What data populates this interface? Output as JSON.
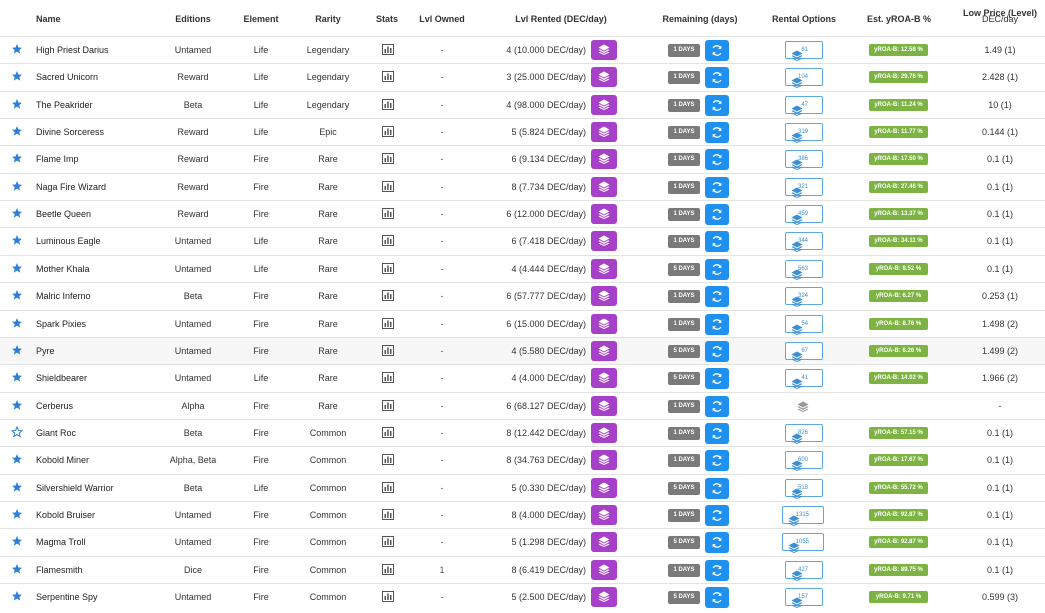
{
  "headers": {
    "name": "Name",
    "editions": "Editions",
    "element": "Element",
    "rarity": "Rarity",
    "stats": "Stats",
    "lvl_owned": "Lvl Owned",
    "lvl_rented": "Lvl Rented",
    "lvl_rented_unit": "(DEC/day)",
    "remaining": "Remaining (days)",
    "rental_options": "Rental Options",
    "est_yroa": "Est. yROA-B %",
    "low_price": "Low Price (Level)",
    "low_price_unit": "DEC/day"
  },
  "colors": {
    "accent_blue": "#1e90f0",
    "purple": "#a640c8",
    "days_badge": "#7a7a7a",
    "yroa_green": "#7cb342"
  },
  "rows": [
    {
      "favorite": true,
      "name": "High Priest Darius",
      "editions": "Untamed",
      "element": "Life",
      "rarity": "Legendary",
      "lvl_owned": "-",
      "lvl": "4",
      "dec": "(10.000 DEC/day)",
      "days": "1 DAYS",
      "rental_count": "81",
      "yroa": "yROA-B: 12.58 %",
      "low_price": "1.49 (1)"
    },
    {
      "favorite": true,
      "name": "Sacred Unicorn",
      "editions": "Reward",
      "element": "Life",
      "rarity": "Legendary",
      "lvl_owned": "-",
      "lvl": "3",
      "dec": "(25.000 DEC/day)",
      "days": "1 DAYS",
      "rental_count": "104",
      "yroa": "yROA-B: 29.76 %",
      "low_price": "2.428 (1)"
    },
    {
      "favorite": true,
      "name": "The Peakrider",
      "editions": "Beta",
      "element": "Life",
      "rarity": "Legendary",
      "lvl_owned": "-",
      "lvl": "4",
      "dec": "(98.000 DEC/day)",
      "days": "1 DAYS",
      "rental_count": "47",
      "yroa": "yROA-B: 11.24 %",
      "low_price": "10 (1)"
    },
    {
      "favorite": true,
      "name": "Divine Sorceress",
      "editions": "Reward",
      "element": "Life",
      "rarity": "Epic",
      "lvl_owned": "-",
      "lvl": "5",
      "dec": "(5.824 DEC/day)",
      "days": "1 DAYS",
      "rental_count": "319",
      "yroa": "yROA-B: 11.77 %",
      "low_price": "0.144 (1)"
    },
    {
      "favorite": true,
      "name": "Flame Imp",
      "editions": "Reward",
      "element": "Fire",
      "rarity": "Rare",
      "lvl_owned": "-",
      "lvl": "6",
      "dec": "(9.134 DEC/day)",
      "days": "1 DAYS",
      "rental_count": "386",
      "yroa": "yROA-B: 17.50 %",
      "low_price": "0.1 (1)"
    },
    {
      "favorite": true,
      "name": "Naga Fire Wizard",
      "editions": "Reward",
      "element": "Fire",
      "rarity": "Rare",
      "lvl_owned": "-",
      "lvl": "8",
      "dec": "(7.734 DEC/day)",
      "days": "1 DAYS",
      "rental_count": "321",
      "yroa": "yROA-B: 27.46 %",
      "low_price": "0.1 (1)"
    },
    {
      "favorite": true,
      "name": "Beetle Queen",
      "editions": "Reward",
      "element": "Fire",
      "rarity": "Rare",
      "lvl_owned": "-",
      "lvl": "6",
      "dec": "(12.000 DEC/day)",
      "days": "1 DAYS",
      "rental_count": "459",
      "yroa": "yROA-B: 13.37 %",
      "low_price": "0.1 (1)"
    },
    {
      "favorite": true,
      "name": "Luminous Eagle",
      "editions": "Untamed",
      "element": "Life",
      "rarity": "Rare",
      "lvl_owned": "-",
      "lvl": "6",
      "dec": "(7.418 DEC/day)",
      "days": "1 DAYS",
      "rental_count": "344",
      "yroa": "yROA-B: 34.11 %",
      "low_price": "0.1 (1)"
    },
    {
      "favorite": true,
      "name": "Mother Khala",
      "editions": "Untamed",
      "element": "Life",
      "rarity": "Rare",
      "lvl_owned": "-",
      "lvl": "4",
      "dec": "(4.444 DEC/day)",
      "days": "5 DAYS",
      "rental_count": "563",
      "yroa": "yROA-B: 8.52 %",
      "low_price": "0.1 (1)"
    },
    {
      "favorite": true,
      "name": "Malric Inferno",
      "editions": "Beta",
      "element": "Fire",
      "rarity": "Rare",
      "lvl_owned": "-",
      "lvl": "6",
      "dec": "(57.777 DEC/day)",
      "days": "1 DAYS",
      "rental_count": "324",
      "yroa": "yROA-B: 6.27 %",
      "low_price": "0.253 (1)"
    },
    {
      "favorite": true,
      "name": "Spark Pixies",
      "editions": "Untamed",
      "element": "Fire",
      "rarity": "Rare",
      "lvl_owned": "-",
      "lvl": "6",
      "dec": "(15.000 DEC/day)",
      "days": "1 DAYS",
      "rental_count": "54",
      "yroa": "yROA-B: 8.76 %",
      "low_price": "1.498 (2)"
    },
    {
      "favorite": true,
      "name": "Pyre",
      "editions": "Untamed",
      "element": "Fire",
      "rarity": "Rare",
      "lvl_owned": "-",
      "lvl": "4",
      "dec": "(5.580 DEC/day)",
      "days": "5 DAYS",
      "rental_count": "67",
      "yroa": "yROA-B: 6.26 %",
      "low_price": "1.499 (2)"
    },
    {
      "favorite": true,
      "name": "Shieldbearer",
      "editions": "Untamed",
      "element": "Life",
      "rarity": "Rare",
      "lvl_owned": "-",
      "lvl": "4",
      "dec": "(4.000 DEC/day)",
      "days": "5 DAYS",
      "rental_count": "41",
      "yroa": "yROA-B: 14.02 %",
      "low_price": "1.966 (2)"
    },
    {
      "favorite": true,
      "name": "Cerberus",
      "editions": "Alpha",
      "element": "Fire",
      "rarity": "Rare",
      "lvl_owned": "-",
      "lvl": "6",
      "dec": "(68.127 DEC/day)",
      "days": "1 DAYS",
      "rental_count": "",
      "yroa": "",
      "low_price": "-"
    },
    {
      "favorite": false,
      "name": "Giant Roc",
      "editions": "Beta",
      "element": "Fire",
      "rarity": "Common",
      "lvl_owned": "-",
      "lvl": "8",
      "dec": "(12.442 DEC/day)",
      "days": "1 DAYS",
      "rental_count": "826",
      "yroa": "yROA-B: 57.15 %",
      "low_price": "0.1 (1)"
    },
    {
      "favorite": true,
      "name": "Kobold Miner",
      "editions": "Alpha, Beta",
      "element": "Fire",
      "rarity": "Common",
      "lvl_owned": "-",
      "lvl": "8",
      "dec": "(34.763 DEC/day)",
      "days": "1 DAYS",
      "rental_count": "600",
      "yroa": "yROA-B: 17.67 %",
      "low_price": "0.1 (1)"
    },
    {
      "favorite": true,
      "name": "Silvershield Warrior",
      "editions": "Beta",
      "element": "Life",
      "rarity": "Common",
      "lvl_owned": "-",
      "lvl": "5",
      "dec": "(0.330 DEC/day)",
      "days": "5 DAYS",
      "rental_count": "518",
      "yroa": "yROA-B: 55.72 %",
      "low_price": "0.1 (1)"
    },
    {
      "favorite": true,
      "name": "Kobold Bruiser",
      "editions": "Untamed",
      "element": "Fire",
      "rarity": "Common",
      "lvl_owned": "-",
      "lvl": "8",
      "dec": "(4.000 DEC/day)",
      "days": "1 DAYS",
      "rental_count": "1315",
      "yroa": "yROA-B: 92.87 %",
      "low_price": "0.1 (1)"
    },
    {
      "favorite": true,
      "name": "Magma Troll",
      "editions": "Untamed",
      "element": "Fire",
      "rarity": "Common",
      "lvl_owned": "-",
      "lvl": "5",
      "dec": "(1.298 DEC/day)",
      "days": "5 DAYS",
      "rental_count": "1055",
      "yroa": "yROA-B: 92.87 %",
      "low_price": "0.1 (1)"
    },
    {
      "favorite": true,
      "name": "Flamesmith",
      "editions": "Dice",
      "element": "Fire",
      "rarity": "Common",
      "lvl_owned": "1",
      "lvl": "8",
      "dec": "(6.419 DEC/day)",
      "days": "1 DAYS",
      "rental_count": "427",
      "yroa": "yROA-B: 89.75 %",
      "low_price": "0.1 (1)"
    },
    {
      "favorite": true,
      "name": "Serpentine Spy",
      "editions": "Untamed",
      "element": "Fire",
      "rarity": "Common",
      "lvl_owned": "-",
      "lvl": "5",
      "dec": "(2.500 DEC/day)",
      "days": "5 DAYS",
      "rental_count": "157",
      "yroa": "yROA-B: 9.71 %",
      "low_price": "0.599 (3)"
    }
  ]
}
